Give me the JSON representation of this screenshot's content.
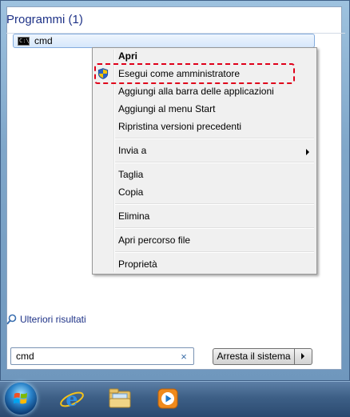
{
  "search_results": {
    "group_title": "Programmi (1)",
    "result_label": "cmd",
    "result_icon_text": "C:\\",
    "more_results": "Ulteriori risultati"
  },
  "context_menu": {
    "items": [
      {
        "label": "Apri"
      },
      {
        "label": "Esegui come amministratore"
      },
      {
        "label": "Aggiungi alla barra delle applicazioni"
      },
      {
        "label": "Aggiungi al menu Start"
      },
      {
        "label": "Ripristina versioni precedenti"
      },
      {
        "label": "Invia a"
      },
      {
        "label": "Taglia"
      },
      {
        "label": "Copia"
      },
      {
        "label": "Elimina"
      },
      {
        "label": "Apri percorso file"
      },
      {
        "label": "Proprietà"
      }
    ],
    "highlighted_item": "Esegui come amministratore",
    "highlight_color": "#e0001a"
  },
  "search_box": {
    "value": "cmd",
    "clear_symbol": "×"
  },
  "shutdown": {
    "label": "Arresta il sistema"
  },
  "taskbar": {
    "icons": [
      "start-orb-icon",
      "internet-explorer-icon",
      "windows-explorer-icon",
      "media-player-icon"
    ]
  },
  "colors": {
    "accent": "#1e3287",
    "selection": "#d6e7fb"
  }
}
